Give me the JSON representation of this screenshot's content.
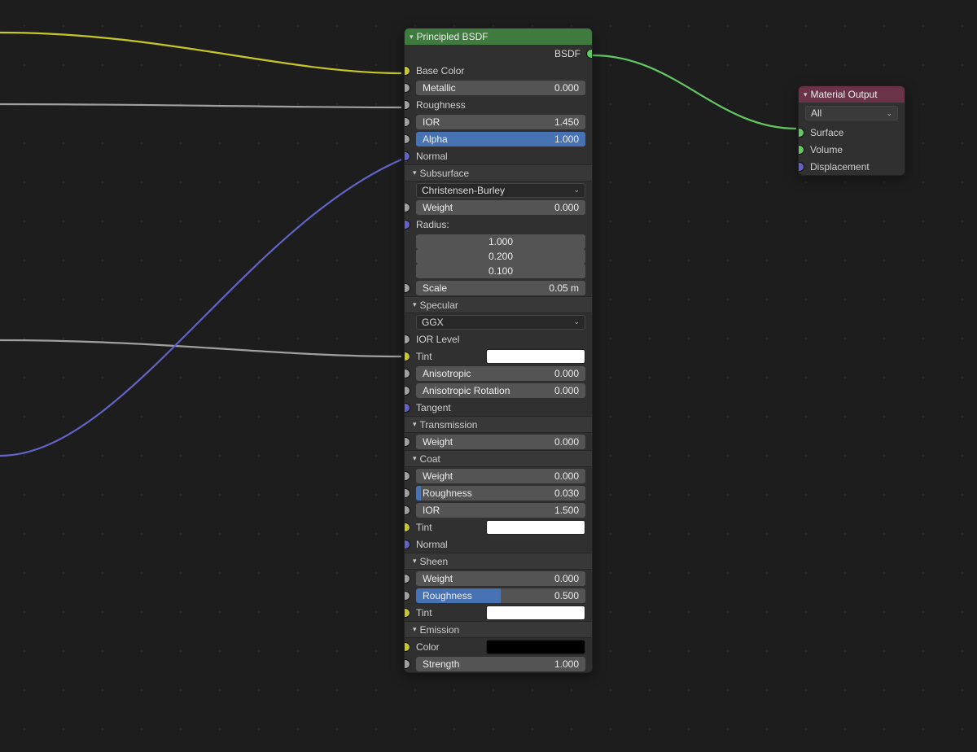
{
  "principled": {
    "title": "Principled BSDF",
    "out": "BSDF",
    "base_color": "Base Color",
    "metallic": {
      "label": "Metallic",
      "value": "0.000",
      "fill": 0
    },
    "roughness": "Roughness",
    "ior": {
      "label": "IOR",
      "value": "1.450",
      "fill": 0
    },
    "alpha": {
      "label": "Alpha",
      "value": "1.000",
      "fill": 100
    },
    "normal": "Normal",
    "subsurface_head": "Subsurface",
    "sss_method": "Christensen-Burley",
    "sss_weight": {
      "label": "Weight",
      "value": "0.000",
      "fill": 0
    },
    "radius_label": "Radius:",
    "radius": [
      "1.000",
      "0.200",
      "0.100"
    ],
    "sss_scale": {
      "label": "Scale",
      "value": "0.05 m",
      "fill": 0
    },
    "specular_head": "Specular",
    "spec_dist": "GGX",
    "ior_level": "IOR Level",
    "spec_tint": "Tint",
    "aniso": {
      "label": "Anisotropic",
      "value": "0.000",
      "fill": 0
    },
    "aniso_rot": {
      "label": "Anisotropic Rotation",
      "value": "0.000",
      "fill": 0
    },
    "tangent": "Tangent",
    "transmission_head": "Transmission",
    "trans_weight": {
      "label": "Weight",
      "value": "0.000",
      "fill": 0
    },
    "coat_head": "Coat",
    "coat_weight": {
      "label": "Weight",
      "value": "0.000",
      "fill": 0
    },
    "coat_rough": {
      "label": "Roughness",
      "value": "0.030",
      "fill": 3
    },
    "coat_ior": {
      "label": "IOR",
      "value": "1.500",
      "fill": 0
    },
    "coat_tint": "Tint",
    "coat_normal": "Normal",
    "sheen_head": "Sheen",
    "sheen_weight": {
      "label": "Weight",
      "value": "0.000",
      "fill": 0
    },
    "sheen_rough": {
      "label": "Roughness",
      "value": "0.500",
      "fill": 50
    },
    "sheen_tint": "Tint",
    "emission_head": "Emission",
    "emission_color": "Color",
    "emission_strength": {
      "label": "Strength",
      "value": "1.000",
      "fill": 0
    }
  },
  "output": {
    "title": "Material Output",
    "target": "All",
    "surface": "Surface",
    "volume": "Volume",
    "displacement": "Displacement"
  }
}
